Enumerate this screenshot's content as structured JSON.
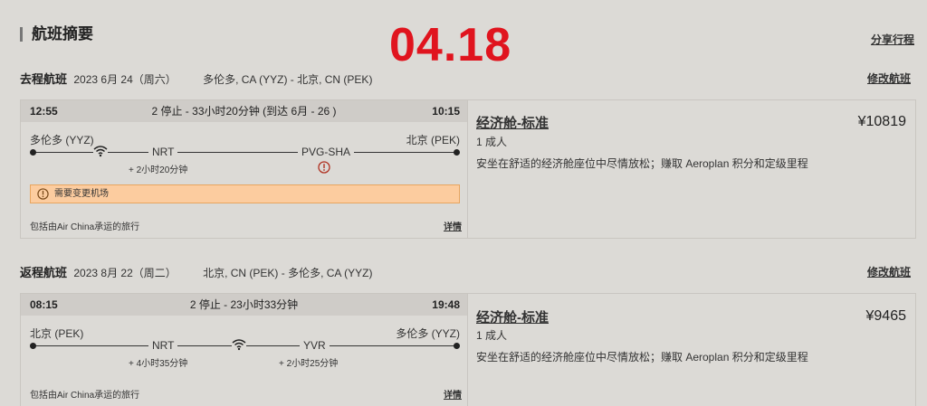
{
  "page": {
    "title": "航班摘要",
    "stamp": "04.18",
    "share_label": "分享行程"
  },
  "outbound": {
    "label": "去程航班",
    "date": "2023 6月 24（周六）",
    "route": "多伦多, CA (YYZ) - 北京, CN (PEK)",
    "modify_label": "修改航班",
    "dep_time": "12:55",
    "arr_time": "10:15",
    "summary": "2 停止 - 33小时20分钟 (到达 6月 - 26 )",
    "origin": "多伦多 (YYZ)",
    "destination": "北京 (PEK)",
    "stops": [
      {
        "code": "NRT",
        "layover": "+ 2小时20分钟"
      },
      {
        "code": "PVG-SHA",
        "layover": ""
      }
    ],
    "notice": "需要变更机场",
    "operated_by": "包括由Air China承运的旅行",
    "details_label": "详情",
    "fare_name": "经济舱-标准",
    "pax": "1 成人",
    "fare_desc": "安坐在舒适的经济舱座位中尽情放松；赚取 Aeroplan 积分和定级里程",
    "price": "¥10819"
  },
  "inbound": {
    "label": "返程航班",
    "date": "2023 8月 22（周二）",
    "route": "北京, CN (PEK) - 多伦多, CA (YYZ)",
    "modify_label": "修改航班",
    "dep_time": "08:15",
    "arr_time": "19:48",
    "summary": "2 停止 - 23小时33分钟",
    "origin": "北京 (PEK)",
    "destination": "多伦多 (YYZ)",
    "stops": [
      {
        "code": "NRT",
        "layover": "+ 4小时35分钟"
      },
      {
        "code": "YVR",
        "layover": "+ 2小时25分钟"
      }
    ],
    "operated_by": "包括由Air China承运的旅行",
    "details_label": "详情",
    "fare_name": "经济舱-标准",
    "pax": "1 成人",
    "fare_desc": "安坐在舒适的经济舱座位中尽情放松；赚取 Aeroplan 积分和定级里程",
    "price": "¥9465"
  },
  "icons": {
    "wifi": "wifi-icon",
    "warning": "warning-icon"
  },
  "colors": {
    "stamp": "#e0141e",
    "notice_bg": "#fccc9f",
    "background": "#dcdad6"
  }
}
